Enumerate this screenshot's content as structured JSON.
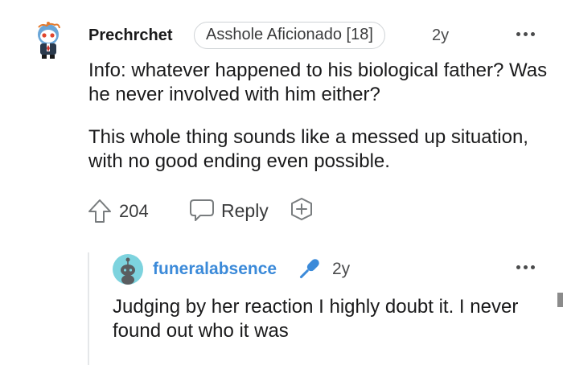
{
  "comment": {
    "avatar_icon": "snoo-avatar-icon",
    "username": "Prechrchet",
    "flair": "Asshole Aficionado [18]",
    "time": "2y",
    "paragraphs": [
      "Info: whatever happened to his biological father? Was he never involved with him either?",
      "This whole thing sounds like a messed up situation, with no good ending even possible."
    ],
    "vote_count": "204",
    "reply_label": "Reply",
    "more_icon": "more-options-icon"
  },
  "reply": {
    "avatar_icon": "snoo-avatar-icon",
    "username": "funeralabsence",
    "badge_icon": "microphone-icon",
    "time": "2y",
    "text": "Judging by her reaction I highly doubt it. I never found out who it was",
    "more_icon": "more-options-icon"
  },
  "colors": {
    "username_link": "#3b8ad9",
    "text": "#1a1a1b",
    "muted": "#4a4b4c",
    "thread_line": "#e5e7e9"
  }
}
